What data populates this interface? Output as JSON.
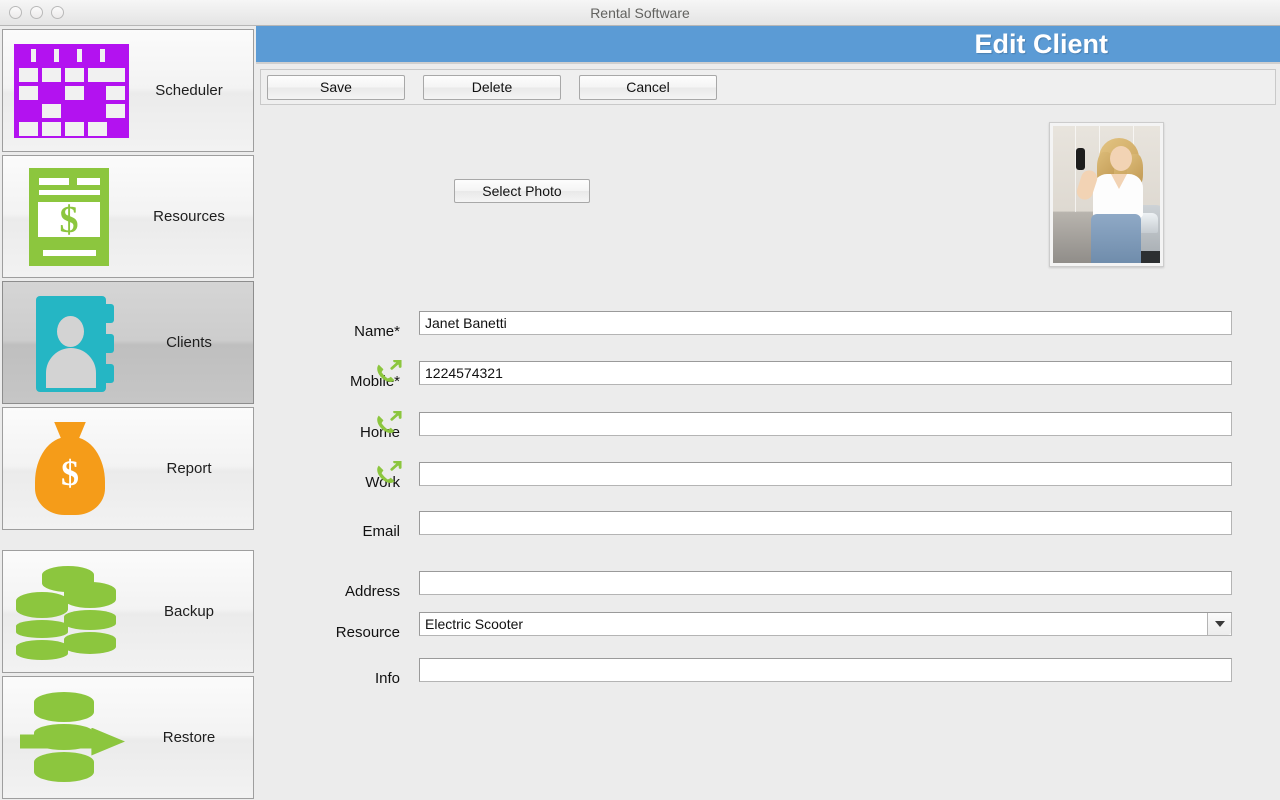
{
  "window": {
    "title": "Rental Software",
    "controls": [
      "close",
      "minimize",
      "zoom"
    ]
  },
  "sidebar": {
    "items": [
      {
        "label": "Scheduler",
        "icon": "calendar-icon",
        "selected": false
      },
      {
        "label": "Resources",
        "icon": "invoice-dollar-icon",
        "selected": false
      },
      {
        "label": "Clients",
        "icon": "address-book-icon",
        "selected": true
      },
      {
        "label": "Report",
        "icon": "money-bag-icon",
        "selected": false
      },
      {
        "label": "Backup",
        "icon": "database-stack-icon",
        "selected": false
      },
      {
        "label": "Restore",
        "icon": "database-restore-icon",
        "selected": false
      }
    ]
  },
  "header": {
    "title": "Edit Client",
    "accent": "#5b9bd5"
  },
  "toolbar": {
    "save_label": "Save",
    "delete_label": "Delete",
    "cancel_label": "Cancel"
  },
  "photo": {
    "select_label": "Select Photo",
    "alt": "woman holding car keys beside car"
  },
  "form": {
    "fields": [
      {
        "label": "Name*",
        "value": "Janet Banetti",
        "placeholder": "",
        "icon": ""
      },
      {
        "label": "Mobile*",
        "value": "1224574321",
        "placeholder": "",
        "icon": "phone-outgoing-icon"
      },
      {
        "label": "Home",
        "value": "",
        "placeholder": "",
        "icon": "phone-outgoing-icon"
      },
      {
        "label": "Work",
        "value": "",
        "placeholder": "",
        "icon": "phone-outgoing-icon"
      },
      {
        "label": "Email",
        "value": "",
        "placeholder": "",
        "icon": ""
      },
      {
        "label": "Address",
        "value": "",
        "placeholder": "",
        "icon": ""
      },
      {
        "label": "Resource",
        "value": "Electric Scooter",
        "placeholder": "",
        "icon": ""
      },
      {
        "label": "Info",
        "value": "",
        "placeholder": "",
        "icon": ""
      }
    ],
    "resource_selected": "Electric Scooter"
  },
  "colors": {
    "accent_blue": "#5b9bd5",
    "green": "#8cc63e",
    "teal": "#25b6c4",
    "orange": "#f59c19",
    "purple": "#b312f0"
  }
}
